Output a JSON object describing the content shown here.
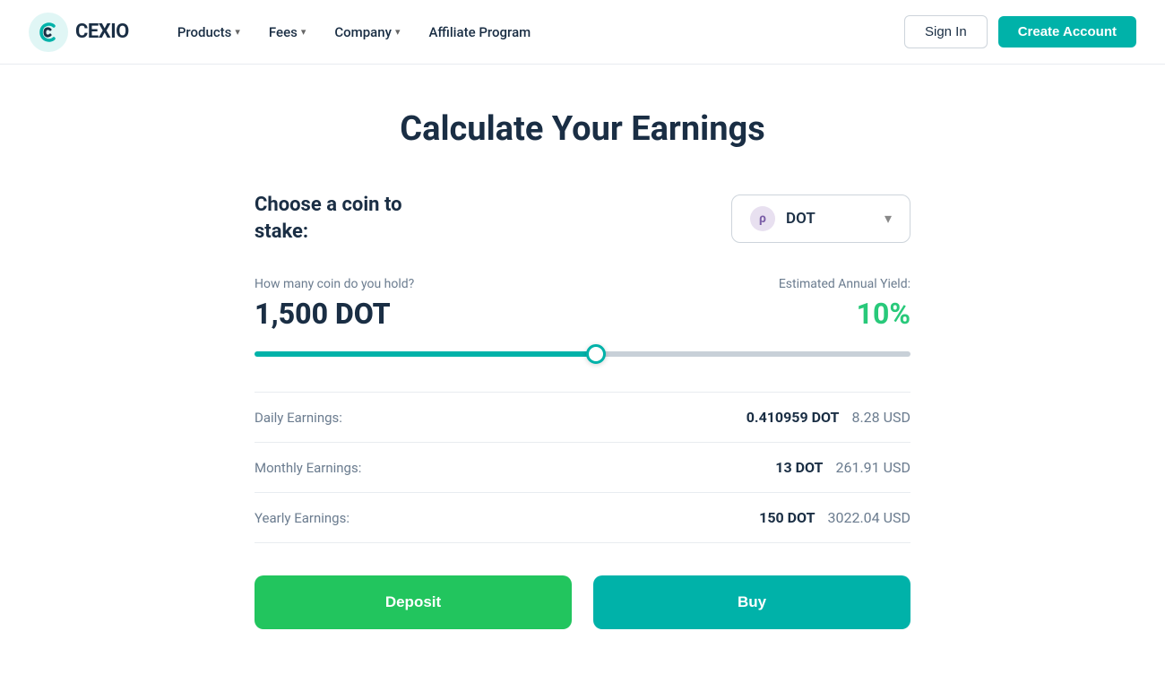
{
  "brand": {
    "logo_text_primary": "CEX",
    "logo_text_secondary": "IO",
    "logo_accent": "#00b2a9"
  },
  "nav": {
    "items": [
      {
        "id": "products",
        "label": "Products",
        "has_dropdown": true
      },
      {
        "id": "fees",
        "label": "Fees",
        "has_dropdown": true
      },
      {
        "id": "company",
        "label": "Company",
        "has_dropdown": true
      },
      {
        "id": "affiliate",
        "label": "Affiliate Program",
        "has_dropdown": false
      }
    ],
    "signin_label": "Sign In",
    "create_account_label": "Create Account"
  },
  "page": {
    "title": "Calculate Your Earnings"
  },
  "calculator": {
    "choose_label_line1": "Choose a coin to",
    "choose_label_line2": "stake:",
    "selected_coin": "DOT",
    "coin_symbol": "ρ",
    "hold_label": "How many coin do you hold?",
    "hold_amount": "1,500 DOT",
    "yield_label": "Estimated Annual Yield:",
    "yield_value": "10%",
    "slider_value": 52,
    "earnings": [
      {
        "label": "Daily Earnings:",
        "dot_value": "0.410959 DOT",
        "usd_value": "8.28 USD"
      },
      {
        "label": "Monthly Earnings:",
        "dot_value": "13 DOT",
        "usd_value": "261.91 USD"
      },
      {
        "label": "Yearly Earnings:",
        "dot_value": "150 DOT",
        "usd_value": "3022.04 USD"
      }
    ],
    "deposit_label": "Deposit",
    "buy_label": "Buy"
  },
  "colors": {
    "teal": "#00b2a9",
    "green": "#22c55e",
    "dark": "#1a2e44",
    "muted": "#6b7c8f"
  }
}
